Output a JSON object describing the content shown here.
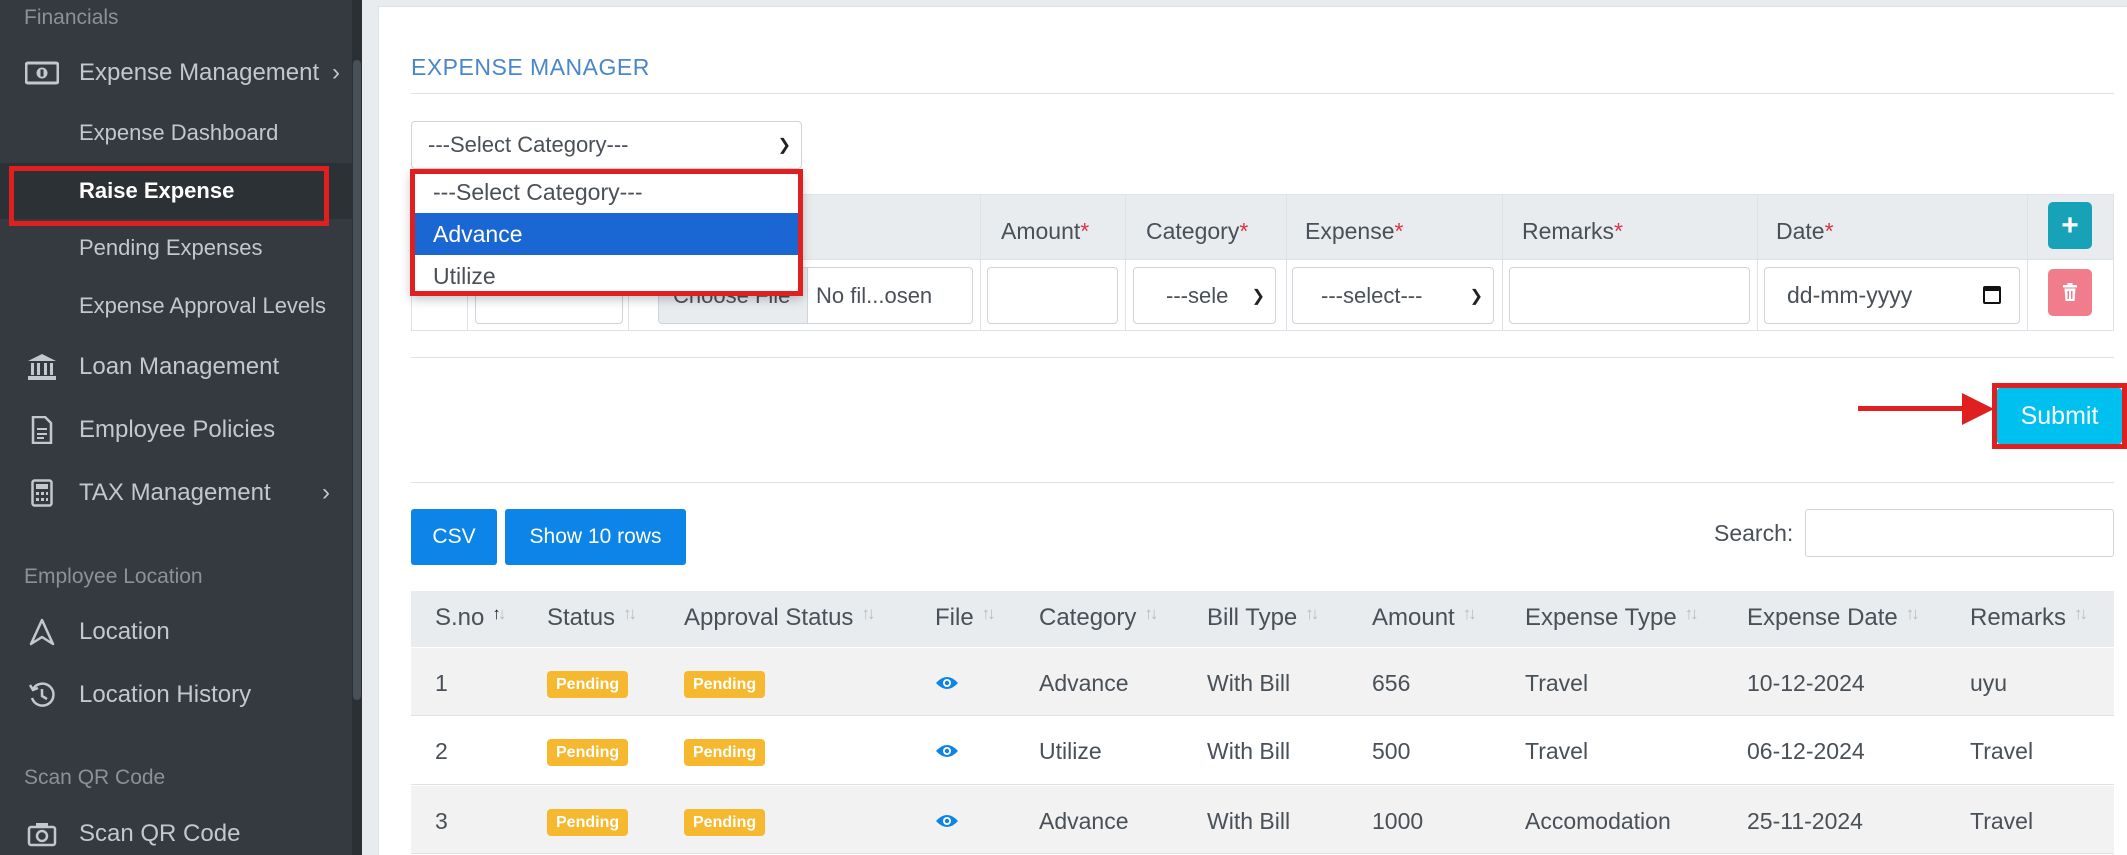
{
  "sidebar": {
    "section_financials": "Financials",
    "expense_management": "Expense Management",
    "expense_dashboard": "Expense Dashboard",
    "raise_expense": "Raise Expense",
    "pending_expenses": "Pending Expenses",
    "expense_approval_levels": "Expense Approval Levels",
    "loan_management": "Loan Management",
    "employee_policies": "Employee Policies",
    "tax_management": "TAX Management",
    "section_location": "Employee Location",
    "location": "Location",
    "location_history": "Location History",
    "section_qr": "Scan QR Code",
    "scan_qr_code": "Scan QR Code"
  },
  "main": {
    "title": "EXPENSE MANAGER",
    "category_select_value": "---Select Category---",
    "dropdown_options": [
      "---Select Category---",
      "Advance",
      "Utilize"
    ],
    "dropdown_selected": "Advance",
    "form_headers": {
      "amount": "Amount",
      "category": "Category",
      "expense": "Expense",
      "remarks": "Remarks",
      "date": "Date",
      "required_mark": "*"
    },
    "file_button": "Choose File",
    "file_name": "No fil...osen",
    "row_category_value": "---sele",
    "row_expense_value": "---select---",
    "date_placeholder": "dd-mm-yyyy",
    "add_label": "+",
    "submit": "Submit"
  },
  "table": {
    "csv": "CSV",
    "show_rows": "Show 10 rows",
    "search_label": "Search:",
    "columns": [
      "S.no",
      "Status",
      "Approval Status",
      "File",
      "Category",
      "Bill Type",
      "Amount",
      "Expense Type",
      "Expense Date",
      "Remarks"
    ],
    "rows": [
      {
        "sno": "1",
        "status": "Pending",
        "approval": "Pending",
        "category": "Advance",
        "bill_type": "With Bill",
        "amount": "656",
        "expense_type": "Travel",
        "date": "10-12-2024",
        "remarks": "uyu"
      },
      {
        "sno": "2",
        "status": "Pending",
        "approval": "Pending",
        "category": "Utilize",
        "bill_type": "With Bill",
        "amount": "500",
        "expense_type": "Travel",
        "date": "06-12-2024",
        "remarks": "Travel"
      },
      {
        "sno": "3",
        "status": "Pending",
        "approval": "Pending",
        "category": "Advance",
        "bill_type": "With Bill",
        "amount": "1000",
        "expense_type": "Accomodation",
        "date": "25-11-2024",
        "remarks": "Travel"
      }
    ]
  },
  "colors": {
    "sidebar_bg": "#343a40",
    "accent_blue": "#0d84e8",
    "submit_cyan": "#00c0ef",
    "badge_yellow": "#f5b82e",
    "annotation_red": "#e02020"
  }
}
